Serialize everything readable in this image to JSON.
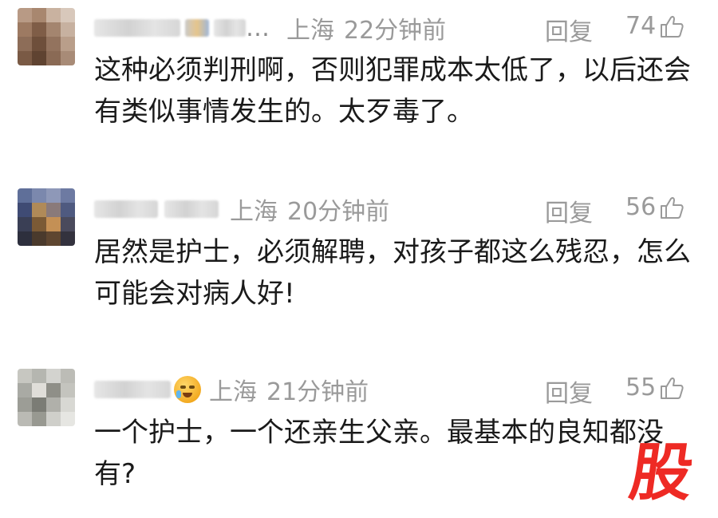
{
  "comments": [
    {
      "location": "上海",
      "time": "22分钟前",
      "reply_label": "回复",
      "likes": "74",
      "text": "这种必须判刑啊，否则犯罪成本太低了，以后还会有类似事情发生的。太歹毒了。",
      "ellipsis": "…"
    },
    {
      "location": "上海",
      "time": "20分钟前",
      "reply_label": "回复",
      "likes": "56",
      "text": "居然是护士，必须解聘，对孩子都这么残忍，怎么可能会对病人好!"
    },
    {
      "location": "上海",
      "time": "21分钟前",
      "reply_label": "回复",
      "likes": "55",
      "text": "一个护士，一个还亲生父亲。最基本的良知都没有?",
      "emoji": "crying-laughing-emoji"
    }
  ],
  "watermark": "股",
  "colors": {
    "meta_gray": "#9a9a9a",
    "text": "#1a1a1a",
    "watermark_red": "#ee2a24"
  }
}
